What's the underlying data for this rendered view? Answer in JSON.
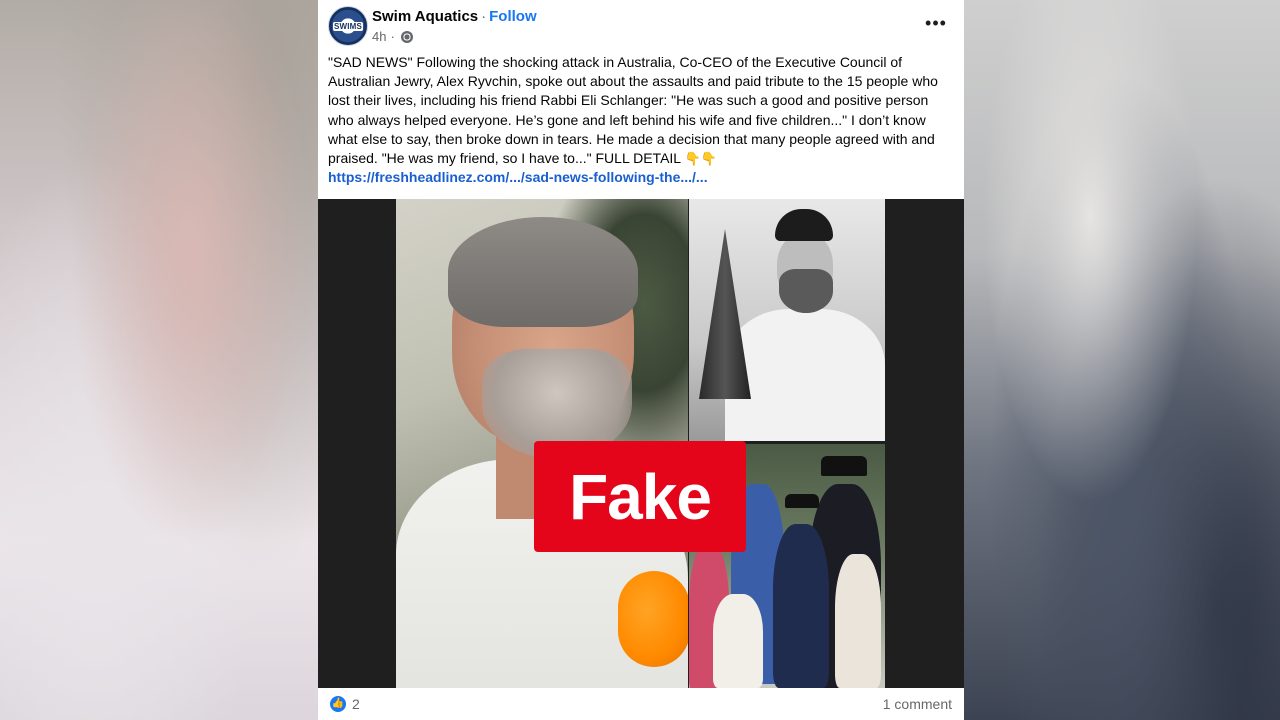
{
  "post": {
    "page_name": "Swim Aquatics",
    "separator": "·",
    "follow_label": "Follow",
    "timestamp": "4h",
    "avatar_text": "SWIMS",
    "more_label": "•••",
    "text": "\"SAD NEWS\" Following the shocking attack in Australia, Co-CEO of the Executive Council of Australian Jewry, Alex Ryvchin, spoke out about the assaults and paid tribute to the 15 people who lost their lives, including his friend Rabbi Eli Schlanger: \"He was such a good and positive person who always helped everyone. He’s gone and left behind his wife and five children...\" I don’t know what else to say, then broke down in tears. He made a decision that many people agreed with and praised. \"He was my friend, so I have to...\" FULL DETAIL",
    "emoji": "👇👇",
    "link": "https://freshheadlinez.com/.../sad-news-following-the.../...",
    "badge": "Fake",
    "like_icon": "👍",
    "like_count": "2",
    "comment_count": "1 comment"
  },
  "colors": {
    "brand_blue": "#1877f2",
    "link_blue": "#1a5fd0",
    "fake_red": "#e5051b",
    "meta_gray": "#65676b"
  },
  "icons": {
    "privacy": "globe-icon",
    "more": "more-options-icon",
    "like": "like-reaction-icon"
  }
}
